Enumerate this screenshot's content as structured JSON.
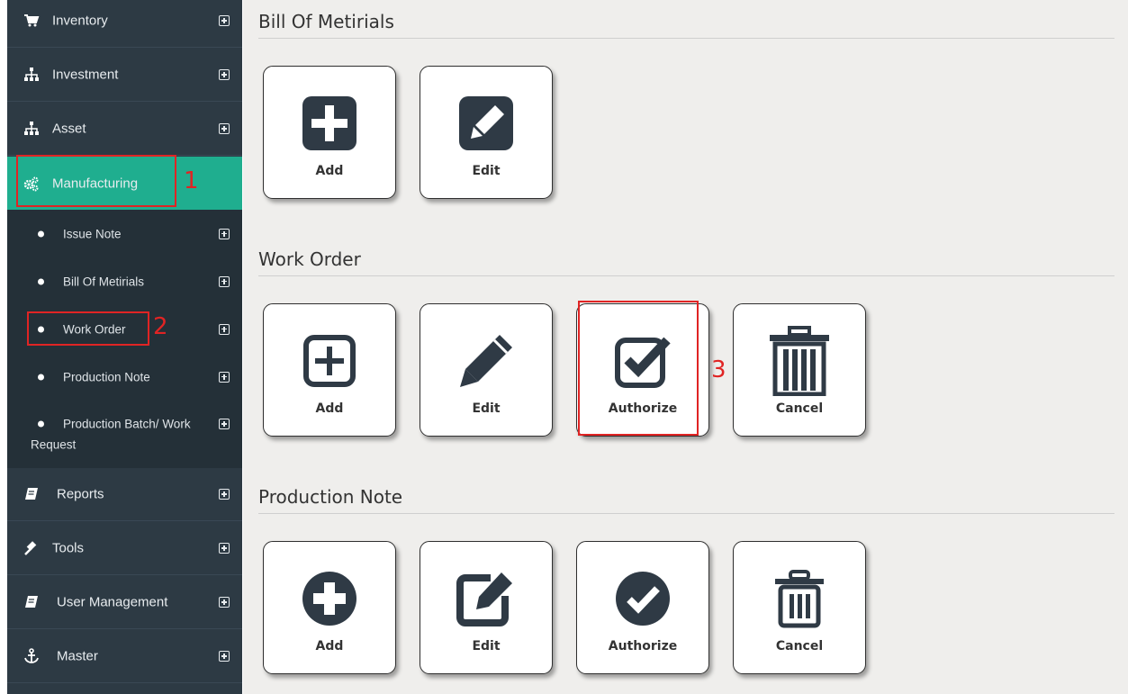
{
  "sidebar": {
    "items": [
      {
        "label": "Inventory",
        "icon": "cart-icon"
      },
      {
        "label": "Investment",
        "icon": "sitemap-icon"
      },
      {
        "label": "Asset",
        "icon": "sitemap-icon"
      },
      {
        "label": "Manufacturing",
        "icon": "cogs-icon",
        "active": true
      },
      {
        "label": "Reports",
        "icon": "book-icon"
      },
      {
        "label": "Tools",
        "icon": "gavel-icon"
      },
      {
        "label": "User Management",
        "icon": "book-icon"
      },
      {
        "label": "Master",
        "icon": "anchor-icon"
      }
    ],
    "subitems": [
      {
        "label": "Issue Note"
      },
      {
        "label": "Bill Of Metirials"
      },
      {
        "label": "Work Order"
      },
      {
        "label": "Production Note"
      },
      {
        "label": "Production Batch/ Work",
        "label2": "Request"
      }
    ],
    "accent_color": "#1fae8f",
    "background_color": "#2d3a44"
  },
  "sections": [
    {
      "title": "Bill Of Metirials",
      "buttons": [
        {
          "label": "Add",
          "icon": "plus-square-icon"
        },
        {
          "label": "Edit",
          "icon": "pencil-square-icon"
        }
      ]
    },
    {
      "title": "Work Order",
      "buttons": [
        {
          "label": "Add",
          "icon": "plus-square-outline-icon"
        },
        {
          "label": "Edit",
          "icon": "pencil-icon"
        },
        {
          "label": "Authorize",
          "icon": "check-square-icon"
        },
        {
          "label": "Cancel",
          "icon": "trash-icon"
        }
      ]
    },
    {
      "title": "Production Note",
      "buttons": [
        {
          "label": "Add",
          "icon": "plus-circle-icon"
        },
        {
          "label": "Edit",
          "icon": "edit-icon"
        },
        {
          "label": "Authorize",
          "icon": "check-circle-icon"
        },
        {
          "label": "Cancel",
          "icon": "trash-outline-icon"
        }
      ]
    }
  ],
  "annotations": {
    "step1": "1",
    "step2": "2",
    "step3": "3",
    "color": "#e02424"
  }
}
